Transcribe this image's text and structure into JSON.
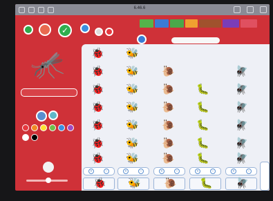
{
  "statusbar": {
    "title": "6.46.6"
  },
  "toolbar": {
    "tabs": [
      {
        "label": "",
        "color": "#55b34a"
      },
      {
        "label": "",
        "color": "#3a7bd5"
      },
      {
        "label": "",
        "color": "#4aa84a"
      },
      {
        "label": "",
        "color": "#f0a030"
      },
      {
        "label": "",
        "color": "#a0522d"
      },
      {
        "label": "",
        "color": "#7a3db8"
      },
      {
        "label": "",
        "color": "#e05060"
      }
    ]
  },
  "sidebar": {
    "name_field": "",
    "palette": [
      "#e6393f",
      "#f08a24",
      "#ffe033",
      "#6fc04a",
      "#3a8fe0",
      "#a04ac0",
      "#ffffff",
      "#000000"
    ]
  },
  "graph": {
    "columns": [
      {
        "name": "ladybug",
        "icon": "🐞",
        "count": 7,
        "label": ""
      },
      {
        "name": "bee",
        "icon": "🐝",
        "count": 7,
        "label": ""
      },
      {
        "name": "snail",
        "icon": "🐌",
        "count": 6,
        "label": ""
      },
      {
        "name": "caterpillar",
        "icon": "🐛",
        "count": 5,
        "label": ""
      },
      {
        "name": "fly",
        "icon": "🪰",
        "count": 6,
        "label": ""
      }
    ]
  }
}
